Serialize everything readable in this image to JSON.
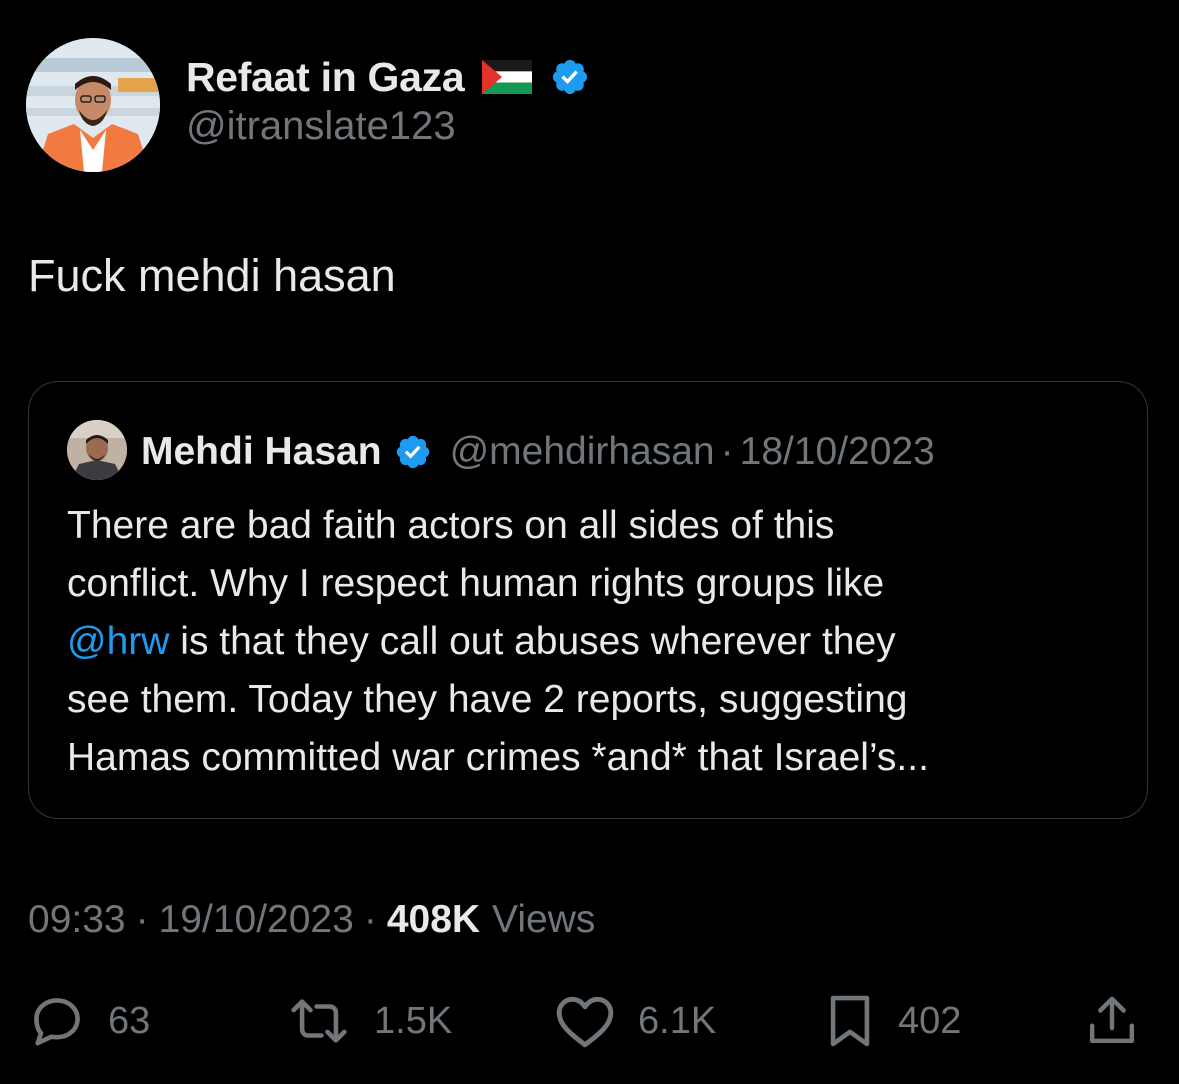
{
  "author": {
    "display_name": "Refaat in Gaza",
    "handle": "@itranslate123",
    "flag_icon": "palestine-flag-icon",
    "verified_icon": "verified-badge-icon",
    "avatar": "profile-photo"
  },
  "tweet": {
    "text": "Fuck mehdi hasan"
  },
  "quote": {
    "display_name": "Mehdi Hasan",
    "verified_icon": "verified-badge-icon",
    "handle": "@mehdirhasan",
    "separator": "·",
    "date": "18/10/2023",
    "body_lines": [
      {
        "text": "There are bad faith actors on all sides of this"
      },
      {
        "text": "conflict. Why I respect human rights groups like"
      },
      {
        "mention": "@hrw",
        "text": " is that they call out abuses wherever they"
      },
      {
        "text": "see them. Today they have 2 reports, suggesting"
      },
      {
        "text": "Hamas committed war crimes *and* that Israel’s..."
      }
    ]
  },
  "meta": {
    "time": "09:33",
    "separator": "·",
    "date": "19/10/2023",
    "views_count": "408K",
    "views_label": "Views"
  },
  "actions": {
    "reply_count": "63",
    "retweet_count": "1.5K",
    "like_count": "6.1K",
    "bookmark_count": "402"
  },
  "colors": {
    "background": "#000000",
    "text_primary": "#e7e9ea",
    "text_secondary": "#71767b",
    "accent_blue": "#1d9bf0",
    "border": "#333639"
  }
}
